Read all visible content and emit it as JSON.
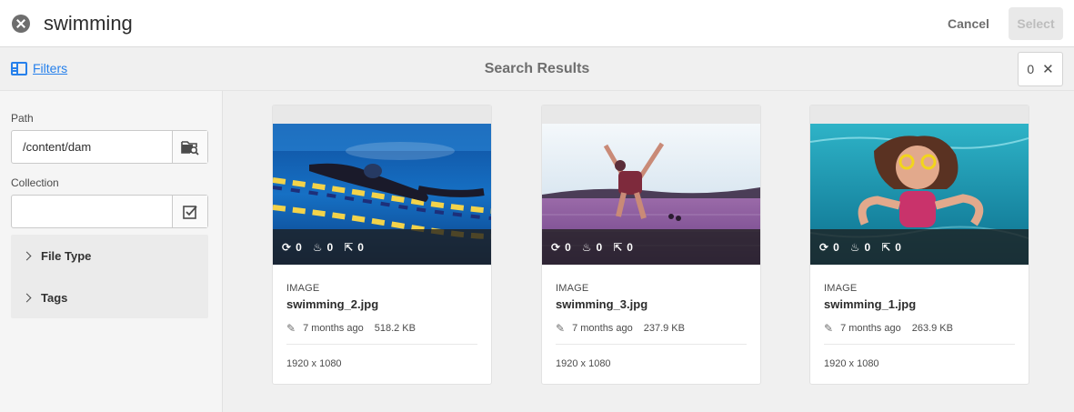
{
  "search": {
    "query": "swimming"
  },
  "header": {
    "cancel_label": "Cancel",
    "select_label": "Select"
  },
  "actionbar": {
    "filters_label": "Filters",
    "title": "Search Results",
    "selected_count": "0"
  },
  "filters": {
    "path_label": "Path",
    "path_value": "/content/dam",
    "collection_label": "Collection",
    "collection_value": "",
    "sections": [
      "File Type",
      "Tags"
    ]
  },
  "results": [
    {
      "type": "IMAGE",
      "name": "swimming_2.jpg",
      "modified": "7 months ago",
      "size": "518.2 KB",
      "dimensions": "1920 x 1080",
      "stats": [
        "0",
        "0",
        "0"
      ]
    },
    {
      "type": "IMAGE",
      "name": "swimming_3.jpg",
      "modified": "7 months ago",
      "size": "237.9 KB",
      "dimensions": "1920 x 1080",
      "stats": [
        "0",
        "0",
        "0"
      ]
    },
    {
      "type": "IMAGE",
      "name": "swimming_1.jpg",
      "modified": "7 months ago",
      "size": "263.9 KB",
      "dimensions": "1920 x 1080",
      "stats": [
        "0",
        "0",
        "0"
      ]
    }
  ],
  "colors": {
    "accent": "#2680eb",
    "rail_bg": "#f5f5f5",
    "page_bg": "#f0f0f0"
  }
}
